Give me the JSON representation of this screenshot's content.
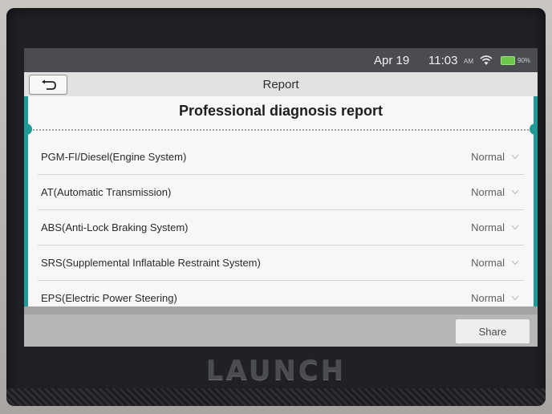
{
  "status_bar": {
    "date": "Apr 19",
    "time": "11:03",
    "ampm": "AM",
    "battery": "90%",
    "icons": [
      "wifi-icon",
      "battery-icon"
    ]
  },
  "title_bar": {
    "back_icon": "back-arrow-icon",
    "title": "Report"
  },
  "report": {
    "heading": "Professional diagnosis report",
    "rows": [
      {
        "label": "PGM-FI/Diesel(Engine System)",
        "status": "Normal"
      },
      {
        "label": "AT(Automatic Transmission)",
        "status": "Normal"
      },
      {
        "label": "ABS(Anti-Lock Braking System)",
        "status": "Normal"
      },
      {
        "label": "SRS(Supplemental Inflatable Restraint System)",
        "status": "Normal"
      },
      {
        "label": "EPS(Electric Power Steering)",
        "status": "Normal"
      }
    ]
  },
  "bottom_bar": {
    "share_label": "Share"
  },
  "device": {
    "brand": "LAUNCH"
  },
  "colors": {
    "accent_teal": "#1e9b97",
    "status_bar": "#4a4c52",
    "battery_green": "#6cc84a"
  }
}
